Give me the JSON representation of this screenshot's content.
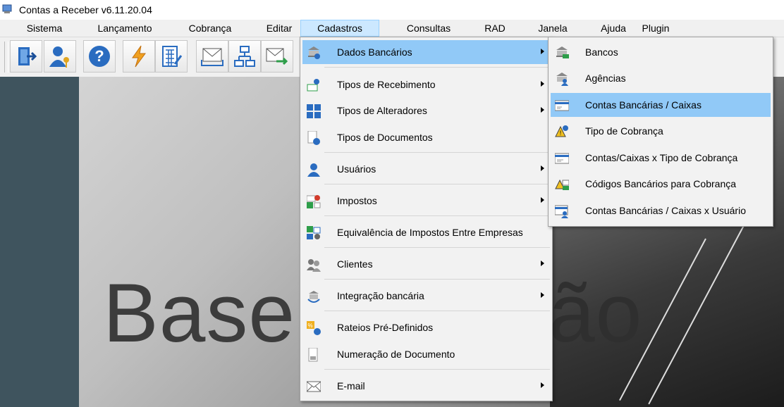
{
  "window": {
    "title": "Contas a Receber v6.11.20.04"
  },
  "menubar": [
    {
      "label": "Sistema"
    },
    {
      "label": "Lançamento"
    },
    {
      "label": "Cobrança"
    },
    {
      "label": "Editar"
    },
    {
      "label": "Cadastros",
      "active": true
    },
    {
      "label": "Consultas"
    },
    {
      "label": "RAD"
    },
    {
      "label": "Janela"
    },
    {
      "label": "Ajuda"
    },
    {
      "label": "Plugin"
    }
  ],
  "toolbar": [
    {
      "icon": "exit-icon"
    },
    {
      "icon": "user-key-icon"
    },
    {
      "icon": "help-icon"
    },
    {
      "icon": "lightning-icon"
    },
    {
      "icon": "calculator-icon"
    },
    {
      "icon": "mail-tray-icon"
    },
    {
      "icon": "hierarchy-icon"
    },
    {
      "icon": "mail-send-icon"
    }
  ],
  "background": {
    "word_left": "Base",
    "word_right": "ão"
  },
  "cadastros_menu": [
    {
      "label": "Dados Bancários",
      "icon": "bank-data-icon",
      "submenu": true,
      "highlighted": true
    },
    {
      "label": "Tipos de Recebimento",
      "icon": "receipt-types-icon",
      "submenu": true
    },
    {
      "label": "Tipos de Alteradores",
      "icon": "calculator-ops-icon",
      "submenu": true
    },
    {
      "label": "Tipos de Documentos",
      "icon": "document-info-icon",
      "submenu": false
    },
    {
      "label": "Usuários",
      "icon": "user-icon",
      "submenu": true
    },
    {
      "label": "Impostos",
      "icon": "taxes-icon",
      "submenu": true
    },
    {
      "label": "Equivalência de Impostos Entre Empresas",
      "icon": "tax-equivalence-icon",
      "submenu": false
    },
    {
      "label": "Clientes",
      "icon": "clients-icon",
      "submenu": true
    },
    {
      "label": "Integração bancária",
      "icon": "bank-integration-icon",
      "submenu": true
    },
    {
      "label": "Rateios Pré-Definidos",
      "icon": "apportionment-icon",
      "submenu": false
    },
    {
      "label": "Numeração de Documento",
      "icon": "document-number-icon",
      "submenu": false
    },
    {
      "label": "E-mail",
      "icon": "envelope-icon",
      "submenu": true
    }
  ],
  "dados_bancarios_submenu": [
    {
      "label": "Bancos",
      "icon": "bank-icon"
    },
    {
      "label": "Agências",
      "icon": "bank-branch-icon"
    },
    {
      "label": "Contas Bancárias / Caixas",
      "icon": "bank-account-icon",
      "highlighted": true
    },
    {
      "label": "Tipo de Cobrança",
      "icon": "billing-type-icon"
    },
    {
      "label": "Contas/Caixas x Tipo de Cobrança",
      "icon": "account-billing-icon"
    },
    {
      "label": "Códigos Bancários para Cobrança",
      "icon": "bank-codes-icon"
    },
    {
      "label": "Contas Bancárias / Caixas x Usuário",
      "icon": "account-user-icon"
    }
  ],
  "colors": {
    "highlight": "#91c9f7",
    "active_menu": "#cce8ff",
    "side_strip": "#3f545e"
  }
}
